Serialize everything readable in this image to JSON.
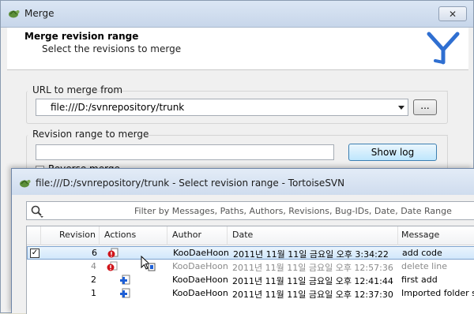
{
  "merge_window": {
    "title": "Merge",
    "close_glyph": "✕",
    "header": {
      "title": "Merge revision range",
      "subtitle": "Select the revisions to merge"
    },
    "url_label": "URL to merge from",
    "url_value": "file:///D:/svnrepository/trunk",
    "browse_label": "...",
    "range_label": "Revision range to merge",
    "range_value": "",
    "show_log_label": "Show log",
    "reverse_label": "Reverse merge"
  },
  "log_window": {
    "title": "file:///D:/svnrepository/trunk - Select revision range - TortoiseSVN",
    "filter_placeholder": "Filter by Messages, Paths, Authors, Revisions, Bug-IDs, Date, Date Range",
    "columns": {
      "revision": "Revision",
      "actions": "Actions",
      "author": "Author",
      "date": "Date",
      "message": "Message"
    },
    "rows": [
      {
        "revision": "6",
        "author": "KooDaeHoon",
        "date": "2011년 11월 11일 금요일 오후 3:34:22",
        "message": "add code",
        "checked": true,
        "selected": true,
        "dim": false,
        "action": "modified"
      },
      {
        "revision": "4",
        "author": "KooDaeHoon",
        "date": "2011년 11월 11일 금요일 오후 12:57:36",
        "message": "delete line",
        "checked": false,
        "selected": false,
        "dim": true,
        "action": "modified"
      },
      {
        "revision": "2",
        "author": "KooDaeHoon",
        "date": "2011년 11월 11일 금요일 오후 12:41:44",
        "message": "first add",
        "checked": false,
        "selected": false,
        "dim": false,
        "action": "added"
      },
      {
        "revision": "1",
        "author": "KooDaeHoon",
        "date": "2011년 11월 11일 금요일 오후 12:37:30",
        "message": "Imported folder structure",
        "checked": false,
        "selected": false,
        "dim": false,
        "action": "added"
      }
    ],
    "check_glyph": "✓"
  },
  "icons": {
    "app": "tortoisesvn-icon",
    "logo": "tortoisesvn-merge-logo-icon",
    "search": "search-icon",
    "modified": "modified-icon",
    "added": "added-icon"
  },
  "colors": {
    "accent": "#2f6fd1",
    "selected_row": "#d1e7fb",
    "modified_red": "#d0141a",
    "added_blue": "#1d5fd6"
  }
}
